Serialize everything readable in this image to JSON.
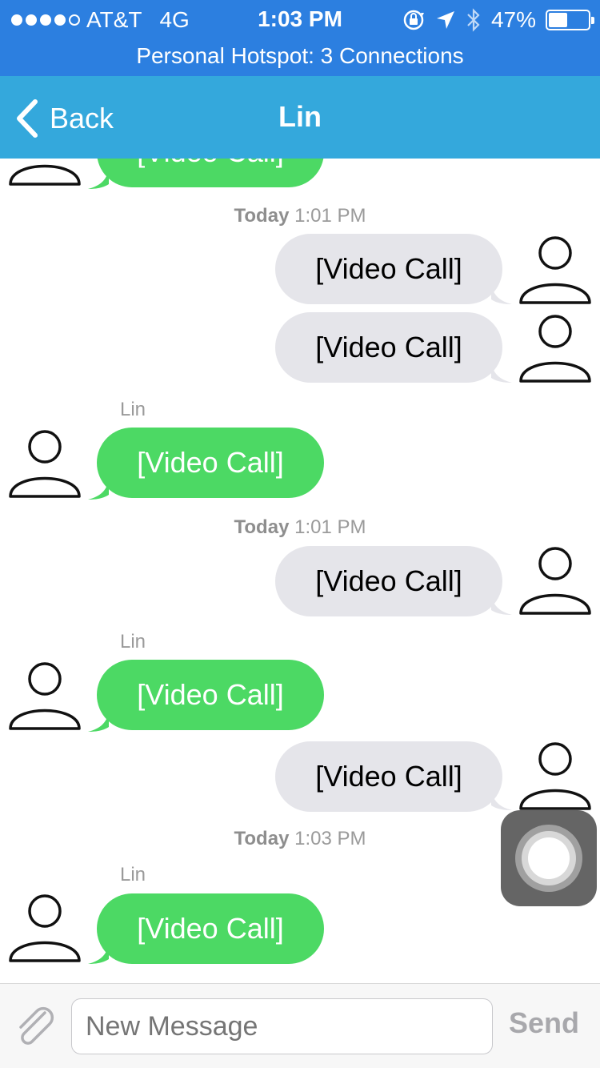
{
  "status_bar": {
    "carrier": "AT&T",
    "network": "4G",
    "time": "1:03 PM",
    "battery_percent": "47%",
    "battery_level": 0.47,
    "signal_bars_filled": 4,
    "signal_bars_total": 5
  },
  "hotspot_banner": "Personal Hotspot: 3 Connections",
  "nav": {
    "back_label": "Back",
    "title": "Lin"
  },
  "messages": {
    "m0": {
      "text": "[Video Call]"
    },
    "t1": {
      "day": "Today",
      "time": "1:01 PM"
    },
    "m1": {
      "text": "[Video Call]"
    },
    "m2": {
      "text": "[Video Call]"
    },
    "s3": "Lin",
    "m3": {
      "text": "[Video Call]"
    },
    "t2": {
      "day": "Today",
      "time": "1:01 PM"
    },
    "m4": {
      "text": "[Video Call]"
    },
    "s5": "Lin",
    "m5": {
      "text": "[Video Call]"
    },
    "m6": {
      "text": "[Video Call]"
    },
    "t3": {
      "day": "Today",
      "time": "1:03 PM"
    },
    "s7": "Lin",
    "m7": {
      "text": "[Video Call]"
    }
  },
  "composer": {
    "placeholder": "New Message",
    "send_label": "Send"
  },
  "colors": {
    "status_bar": "#2c7fe0",
    "nav_bar": "#34a8dc",
    "incoming_bubble": "#4cd964",
    "outgoing_bubble": "#e5e5ea"
  },
  "icons": {
    "back": "chevron-left-icon",
    "attach": "paperclip-icon",
    "avatar": "person-outline-icon",
    "location": "location-arrow-icon",
    "bluetooth": "bluetooth-icon",
    "rotation_lock": "rotation-lock-icon",
    "assistive_touch": "assistive-touch-icon"
  }
}
